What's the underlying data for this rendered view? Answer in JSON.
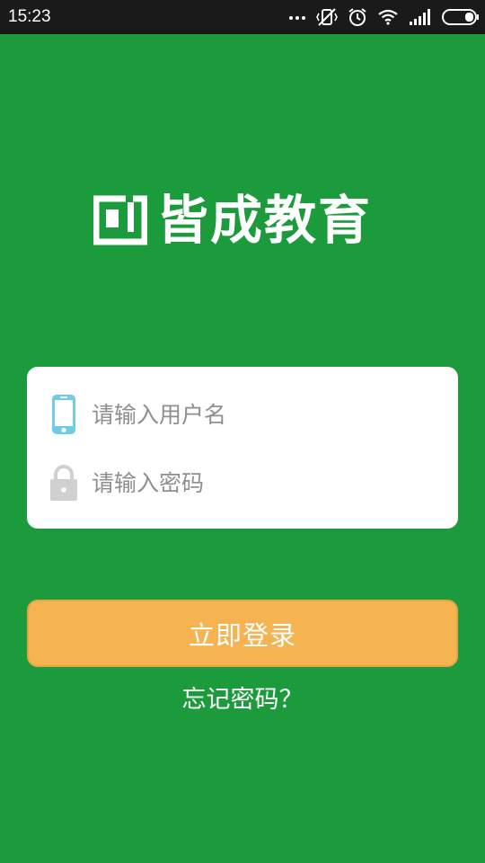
{
  "status_bar": {
    "time": "15:23",
    "icons": [
      "more-dots-icon",
      "vibrate-icon",
      "alarm-icon",
      "wifi-icon",
      "signal-icon",
      "battery-icon"
    ]
  },
  "logo": {
    "text": "皆成教育",
    "mark_icon": "brand-logo-mark"
  },
  "login_form": {
    "username": {
      "placeholder": "请输入用户名",
      "value": "",
      "icon": "phone-icon"
    },
    "password": {
      "placeholder": "请输入密码",
      "value": "",
      "icon": "lock-icon"
    },
    "submit_label": "立即登录",
    "forgot_password_label": "忘记密码？"
  },
  "colors": {
    "background": "#1c9b3c",
    "card": "#ffffff",
    "button": "#f6b352",
    "phone_icon": "#6fcbe6",
    "lock_icon": "#d0d0d0"
  }
}
